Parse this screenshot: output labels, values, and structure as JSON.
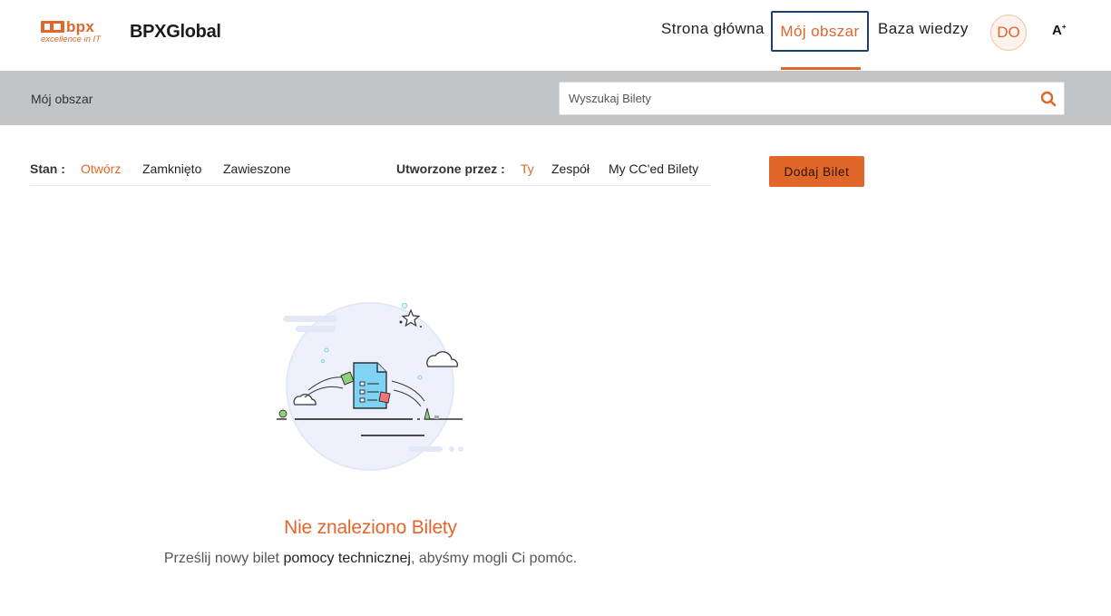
{
  "header": {
    "logo_text": "bpx",
    "logo_tagline": "excellence in IT",
    "brand": "BPXGlobal",
    "nav": {
      "home": "Strona główna",
      "mine": "Mój obszar",
      "knowledge_base": "Baza wiedzy"
    },
    "avatar_initials": "DO",
    "font_toggle": "A",
    "font_toggle_sup": "+"
  },
  "subbar": {
    "title": "Mój obszar",
    "search_placeholder": "Wyszukaj Bilety"
  },
  "filters": {
    "state_label": "Stan :",
    "states": [
      "Otwórz",
      "Zamknięto",
      "Zawieszone"
    ],
    "created_by_label": "Utworzone przez :",
    "creators": [
      "Ty",
      "Zespół",
      "My CC'ed Bilety"
    ]
  },
  "actions": {
    "add_ticket": "Dodaj Bilet"
  },
  "empty_state": {
    "title": "Nie znaleziono Bilety",
    "text_before": "Prześlij nowy bilet ",
    "text_emphasis": "pomocy technicznej",
    "text_after": ", abyśmy mogli Ci pomóc."
  },
  "colors": {
    "accent": "#e0662a",
    "subbar": "#c1c4c7",
    "nav_focus": "#1f3f6e"
  }
}
